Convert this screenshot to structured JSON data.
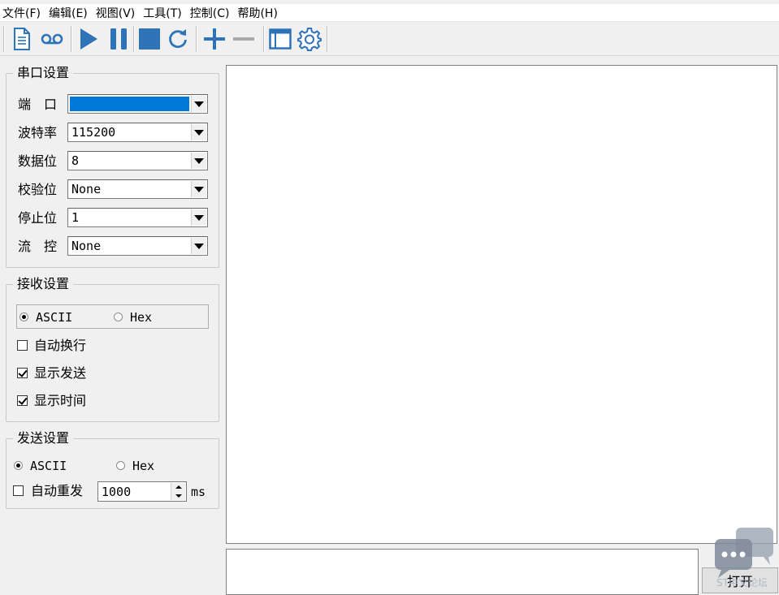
{
  "menu": [
    "文件(F)",
    "编辑(E)",
    "视图(V)",
    "工具(T)",
    "控制(C)",
    "帮助(H)"
  ],
  "toolbar": {
    "icons": [
      "new-file-icon",
      "record-icon",
      "play-icon",
      "pause-icon",
      "stop-icon",
      "refresh-icon",
      "add-icon",
      "remove-icon",
      "window-icon",
      "settings-icon"
    ],
    "accent": "#2e72b8"
  },
  "serial": {
    "title": "串口设置",
    "port_label": "端　口",
    "port_value": "",
    "baud_label": "波特率",
    "baud_value": "115200",
    "databits_label": "数据位",
    "databits_value": "8",
    "parity_label": "校验位",
    "parity_value": "None",
    "stopbits_label": "停止位",
    "stopbits_value": "1",
    "flow_label": "流　控",
    "flow_value": "None",
    "selection_color": "#0078d7"
  },
  "receive": {
    "title": "接收设置",
    "ascii_label": "ASCII",
    "hex_label": "Hex",
    "mode": "ASCII",
    "auto_wrap_label": "自动换行",
    "auto_wrap": false,
    "show_send_label": "显示发送",
    "show_send": true,
    "show_time_label": "显示时间",
    "show_time": true
  },
  "send": {
    "title": "发送设置",
    "ascii_label": "ASCII",
    "hex_label": "Hex",
    "mode": "ASCII",
    "auto_resend_label": "自动重发",
    "auto_resend": false,
    "interval_value": "1000",
    "unit": "ms"
  },
  "open_button": "打开",
  "watermark_text": "ST中文论坛"
}
